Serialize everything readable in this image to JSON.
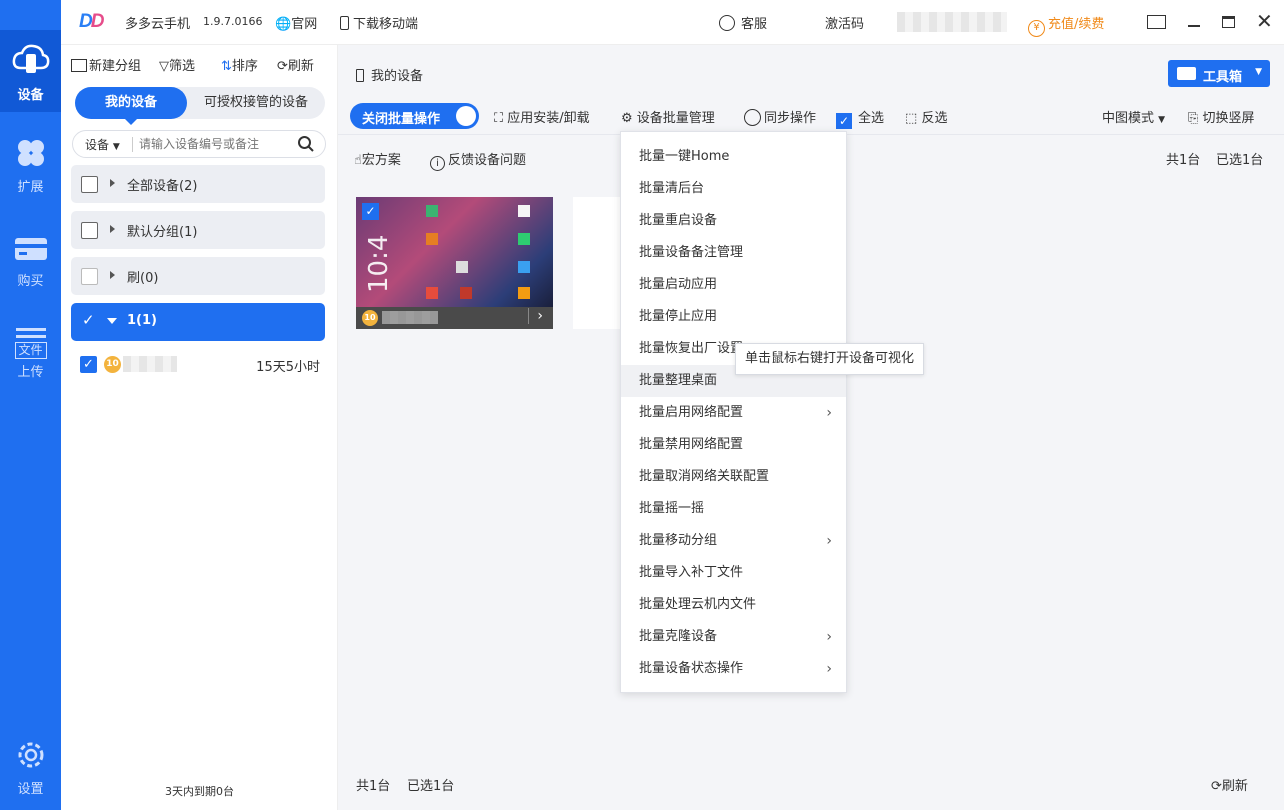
{
  "app": {
    "name": "多多云手机",
    "version": "1.9.7.0166",
    "official_site": "官网",
    "download_mobile": "下载移动端",
    "support": "客服",
    "activation_code": "激活码",
    "recharge": "充值/续费",
    "brand_color": "#1f6ff0",
    "accent_orange": "#f08a1a"
  },
  "rail": {
    "devices": "设备",
    "extend": "扩展",
    "buy": "购买",
    "file_tag": "文件",
    "upload": "上传",
    "settings": "设置"
  },
  "sidebar": {
    "new_group": "新建分组",
    "filter": "筛选",
    "sort": "排序",
    "refresh": "刷新",
    "tab_mine": "我的设备",
    "tab_authorized": "可授权接管的设备",
    "search_scope": "设备",
    "search_placeholder": "请输入设备编号或备注",
    "groups": [
      {
        "label": "全部设备(2)"
      },
      {
        "label": "默认分组(1)"
      },
      {
        "label": "刷(0)"
      },
      {
        "label": "1(1)"
      }
    ],
    "device_row": {
      "time": "15天5小时",
      "vip_level": "10"
    },
    "footer": "3天内到期0台"
  },
  "main": {
    "breadcrumb": "我的设备",
    "toolbox": "工具箱",
    "batch_toggle": "关闭批量操作",
    "app_install": "应用安装/卸载",
    "device_batch": "设备批量管理",
    "sync_op": "同步操作",
    "select_all": "全选",
    "invert": "反选",
    "view_mode": "中图模式",
    "switch_screen": "切换竖屏",
    "macro": "宏方案",
    "feedback": "反馈设备问题",
    "total_top": "共1台",
    "selected_top": "已选1台",
    "total_bottom": "共1台",
    "selected_bottom": "已选1台",
    "refresh_bottom": "刷新"
  },
  "menu": {
    "items": [
      {
        "label": "批量一键Home"
      },
      {
        "label": "批量清后台"
      },
      {
        "label": "批量重启设备"
      },
      {
        "label": "批量设备备注管理"
      },
      {
        "label": "批量启动应用"
      },
      {
        "label": "批量停止应用"
      },
      {
        "label": "批量恢复出厂设置"
      },
      {
        "label": "批量整理桌面"
      },
      {
        "label": "批量启用网络配置"
      },
      {
        "label": "批量禁用网络配置"
      },
      {
        "label": "批量取消网络关联配置"
      },
      {
        "label": "批量摇一摇"
      },
      {
        "label": "批量移动分组"
      },
      {
        "label": "批量导入补丁文件"
      },
      {
        "label": "批量处理云机内文件"
      },
      {
        "label": "批量克隆设备"
      },
      {
        "label": "批量设备状态操作"
      }
    ],
    "tooltip": "单击鼠标右键打开设备可视化"
  }
}
